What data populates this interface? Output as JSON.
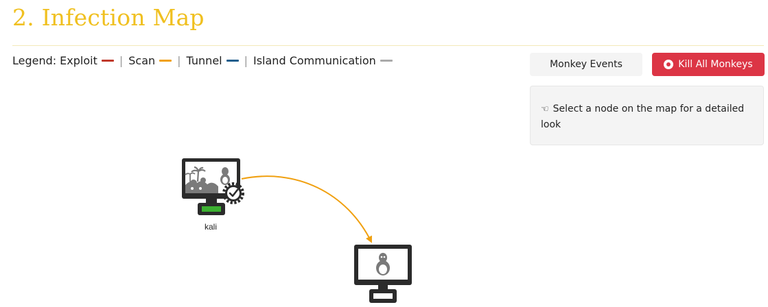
{
  "header": {
    "title": "2. Infection Map"
  },
  "legend": {
    "label": "Legend:",
    "items": [
      {
        "label": "Exploit",
        "color": "#c0392b"
      },
      {
        "label": "Scan",
        "color": "#f0a010"
      },
      {
        "label": "Tunnel",
        "color": "#1f5e8c"
      },
      {
        "label": "Island Communication",
        "color": "#aaaaaa"
      }
    ],
    "separator": "|"
  },
  "buttons": {
    "monkey_events": "Monkey Events",
    "kill_all": "Kill All Monkeys"
  },
  "info_panel": {
    "icon": "pointing-hand-icon",
    "message": "Select a node on the map for a detailed look"
  },
  "map": {
    "nodes": [
      {
        "label": "kali",
        "icon": "monkey-island-linux-node-icon",
        "status": "running"
      },
      {
        "label": "",
        "icon": "linux-machine-node-icon",
        "status": "unknown"
      }
    ],
    "edges": [
      {
        "type": "scan",
        "color": "#f0a010"
      }
    ]
  },
  "colors": {
    "title": "#f0c020",
    "kill_button": "#dc3545",
    "node_dark": "#2b2b2b",
    "running_green": "#3cb031"
  }
}
